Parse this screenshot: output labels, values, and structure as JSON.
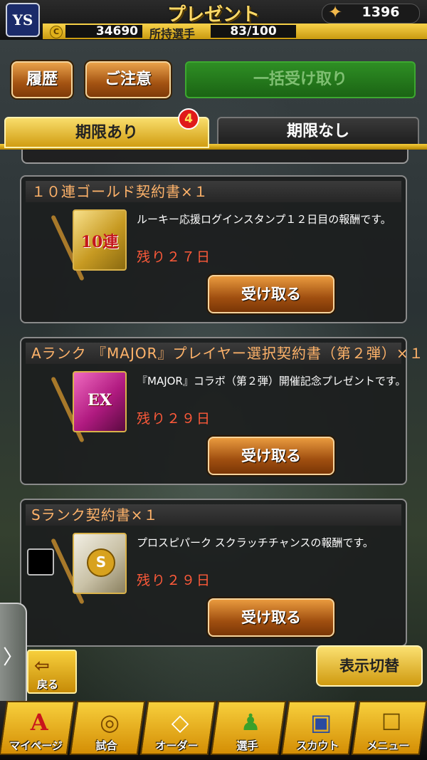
{
  "header": {
    "title": "プレゼント",
    "gem_count": "1396",
    "coins": "34690",
    "players_label": "所持選手",
    "players_value": "83/100",
    "logo_text": "YS"
  },
  "actions": {
    "history": "履歴",
    "notice": "ご注意",
    "receive_all": "一括受け取り"
  },
  "tabs": {
    "with_limit": "期限あり",
    "with_limit_badge": "4",
    "no_limit": "期限なし"
  },
  "presents": [
    {
      "title": "１０連ゴールド契約書×１",
      "image_label": "10連",
      "description": "ルーキー応援ログインスタンプ１２日目の報酬です。",
      "remaining": "残り２７日",
      "receive_label": "受け取る"
    },
    {
      "title": "Aランク 『MAJOR』プレイヤー選択契約書（第２弾）×１",
      "image_label": "EX",
      "description": "『MAJOR』コラボ（第２弾）開催記念プレゼントです。",
      "remaining": "残り２９日",
      "receive_label": "受け取る"
    },
    {
      "title": "Sランク契約書×１",
      "image_label": "S",
      "description": "プロスピパーク スクラッチチャンスの報酬です。",
      "remaining": "残り２９日",
      "receive_label": "受け取る"
    }
  ],
  "bottom": {
    "side_tab": "〉",
    "back": "戻る",
    "toggle_display": "表示切替"
  },
  "nav": [
    {
      "label": "マイページ",
      "icon": "mypage-icon",
      "glyph": "A"
    },
    {
      "label": "試合",
      "icon": "stadium-icon",
      "glyph": "◎"
    },
    {
      "label": "オーダー",
      "icon": "order-icon",
      "glyph": "◇"
    },
    {
      "label": "選手",
      "icon": "player-icon",
      "glyph": "♟"
    },
    {
      "label": "スカウト",
      "icon": "scout-icon",
      "glyph": "▣"
    },
    {
      "label": "メニュー",
      "icon": "menu-icon",
      "glyph": "☐"
    }
  ],
  "colors": {
    "accent_gold": "#f6cd3b",
    "button_brown": "#a45312",
    "button_green": "#2e8e24",
    "remaining_red": "#ff5a3a",
    "title_orange": "#ffb36a"
  }
}
